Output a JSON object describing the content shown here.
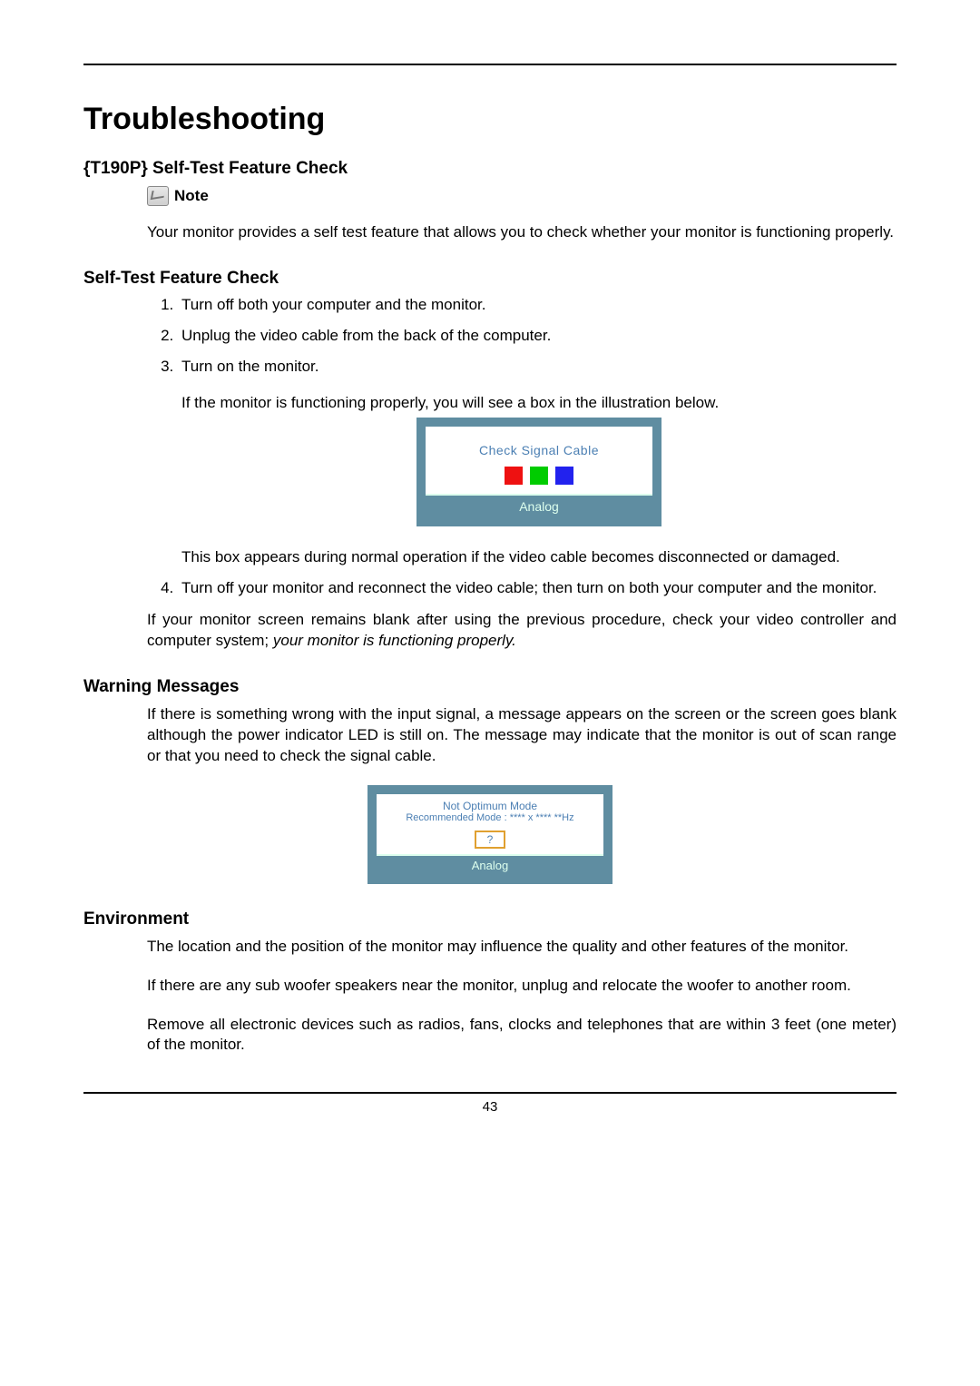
{
  "title": "Troubleshooting",
  "section1": {
    "heading": "{T190P} Self-Test Feature Check",
    "note_label": "Note",
    "note_text": "Your monitor provides a self test feature that allows you to check whether your monitor is functioning properly."
  },
  "section2": {
    "heading": "Self-Test Feature Check",
    "steps": {
      "s1": "Turn off both your computer and the monitor.",
      "s2": "Unplug the video cable from the back of the computer.",
      "s3": "Turn on the monitor.",
      "s3p1": "If the monitor is functioning properly, you will see a box in the illustration below.",
      "s3p2": "This box appears during normal operation if the video cable becomes disconnected or damaged.",
      "s4": "Turn off your monitor and reconnect the video cable; then turn on both your computer and the monitor."
    },
    "closing_a": "If your monitor screen remains blank after using the previous procedure, check your video controller and computer system; ",
    "closing_b": "your monitor is functioning properly."
  },
  "osd1": {
    "title": "Check Signal Cable",
    "footer": "Analog"
  },
  "section3": {
    "heading": "Warning Messages",
    "text": "If there is something wrong with the input signal, a message appears on the screen or the screen goes blank although the power indicator LED is still on. The message may indicate that the monitor is out of scan range or that you need to check the signal cable."
  },
  "osd2": {
    "line1": "Not Optimum Mode",
    "line2": "Recommended Mode : **** x ****  **Hz",
    "q": "?",
    "footer": "Analog"
  },
  "section4": {
    "heading": "Environment",
    "p1": "The location and the position of the monitor may influence the quality and other features of the monitor.",
    "p2": "If there are any sub woofer speakers near the monitor, unplug and relocate the woofer to another room.",
    "p3": "Remove all electronic devices such as radios, fans, clocks and telephones that are within 3 feet (one meter) of the monitor."
  },
  "page_number": "43"
}
